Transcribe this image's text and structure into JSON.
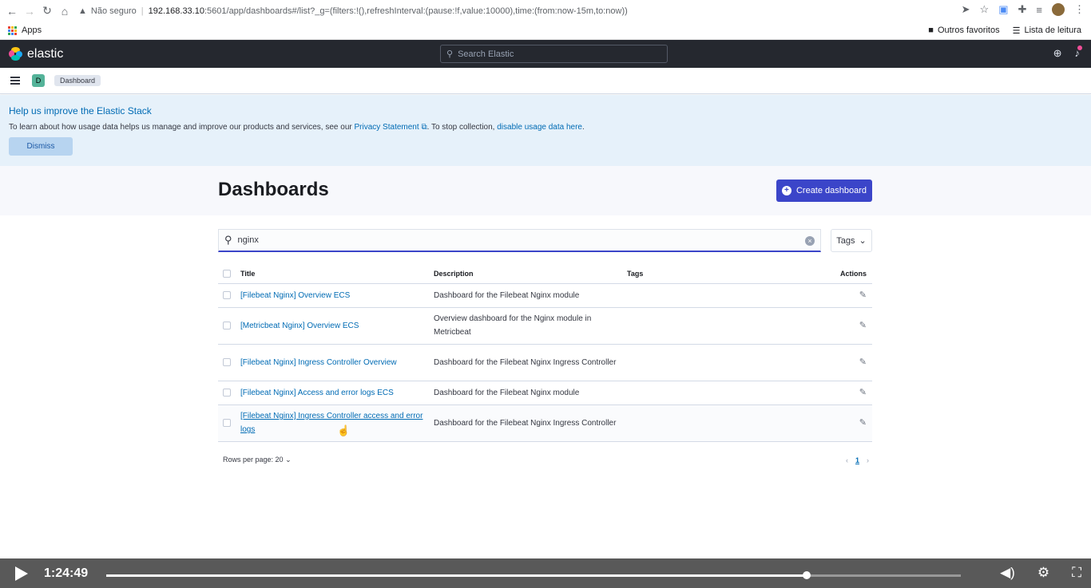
{
  "browser": {
    "nonsecure_label": "Não seguro",
    "url_host": "192.168.33.10",
    "url_path": ":5601/app/dashboards#/list?_g=(filters:!(),refreshInterval:(pause:!f,value:10000),time:(from:now-15m,to:now))",
    "bookmarks_apps": "Apps",
    "bookmarks_others": "Outros favoritos",
    "reading_list": "Lista de leitura"
  },
  "kibana": {
    "logo_text": "elastic",
    "search_placeholder": "Search Elastic",
    "space_initial": "D",
    "breadcrumb": "Dashboard"
  },
  "callout": {
    "title": "Help us improve the Elastic Stack",
    "text_before": "To learn about how usage data helps us manage and improve our products and services, see our ",
    "privacy_link": "Privacy Statement",
    "text_middle": ". To stop collection, ",
    "disable_link": "disable usage data here",
    "text_after": ".",
    "dismiss_label": "Dismiss"
  },
  "page": {
    "title": "Dashboards",
    "create_label": "Create dashboard"
  },
  "search": {
    "value": "nginx",
    "tags_label": "Tags"
  },
  "table": {
    "headers": {
      "title": "Title",
      "description": "Description",
      "tags": "Tags",
      "actions": "Actions"
    },
    "rows": [
      {
        "title": "[Filebeat Nginx] Overview ECS",
        "description": "Dashboard for the Filebeat Nginx module"
      },
      {
        "title": "[Metricbeat Nginx] Overview ECS",
        "description": "Overview dashboard for the Nginx module in Metricbeat"
      },
      {
        "title": "[Filebeat Nginx] Ingress Controller Overview",
        "description": "Dashboard for the Filebeat Nginx Ingress Controller"
      },
      {
        "title": "[Filebeat Nginx] Access and error logs ECS",
        "description": "Dashboard for the Filebeat Nginx module"
      },
      {
        "title": "[Filebeat Nginx] Ingress Controller access and error logs",
        "description": "Dashboard for the Filebeat Nginx Ingress Controller"
      }
    ]
  },
  "pagination": {
    "rows_per_page": "Rows per page: 20",
    "current_page": "1"
  },
  "video": {
    "time": "1:24:49",
    "progress": 0.82
  },
  "colors": {
    "accent": "#3b45c9",
    "link": "#006bb4",
    "header_bg": "#25282f"
  }
}
